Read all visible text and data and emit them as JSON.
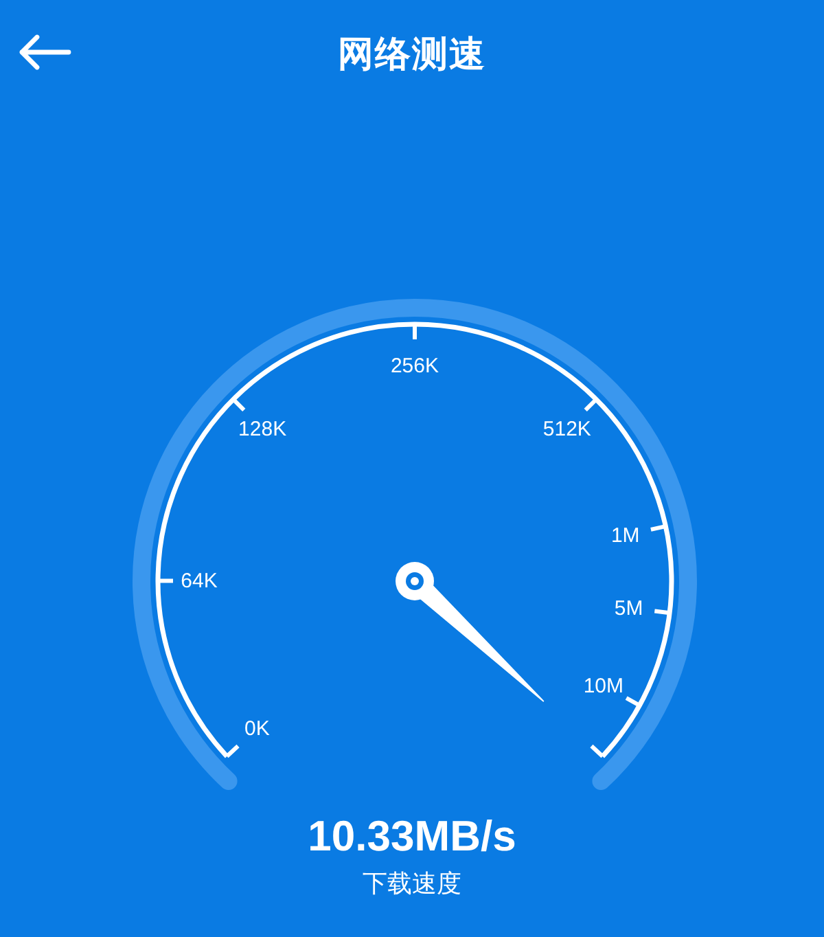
{
  "header": {
    "title": "网络测速"
  },
  "gauge": {
    "tick_labels": [
      "0K",
      "64K",
      "128K",
      "256K",
      "512K",
      "1M",
      "5M",
      "10M"
    ]
  },
  "speed": {
    "value": "10.33MB/s",
    "label": "下载速度"
  }
}
